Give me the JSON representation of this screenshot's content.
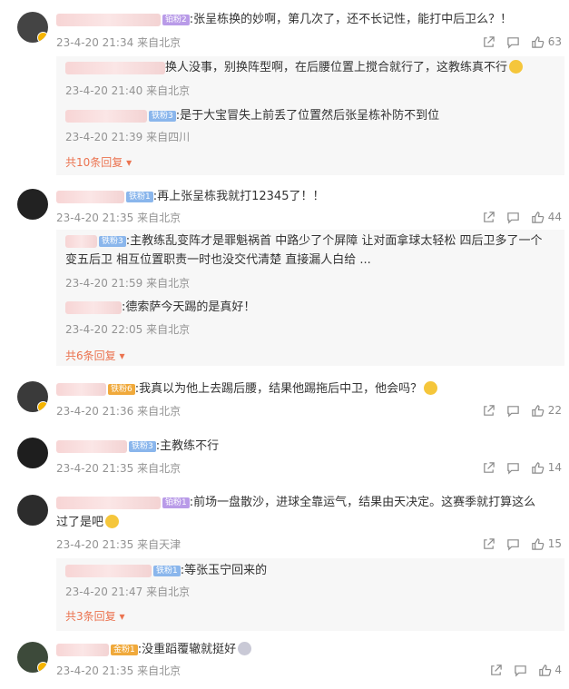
{
  "comments": [
    {
      "badge": "铂粉2",
      "text": ":张呈栋换的妙啊，第几次了，还不长记性，能打中后卫么？！",
      "time": "23-4-20 21:34",
      "location": "来自北京",
      "likes": "63",
      "replies": [
        {
          "text": "换人没事，别换阵型啊，在后腰位置上搅合就行了，这教练真不行",
          "time": "23-4-20 21:40",
          "location": "来自北京"
        },
        {
          "badge": "铁粉3",
          "text": ":是于大宝冒失上前丢了位置然后张呈栋补防不到位",
          "time": "23-4-20 21:39",
          "location": "来自四川"
        }
      ],
      "more": "共10条回复"
    },
    {
      "badge": "铁粉1",
      "text": ":再上张呈栋我就打12345了！！",
      "time": "23-4-20 21:35",
      "location": "来自北京",
      "likes": "44",
      "replies": [
        {
          "badge": "铁粉3",
          "text": ":主教练乱变阵才是罪魁祸首 中路少了个屏障 让对面拿球太轻松  四后卫多了一个",
          "text2": "变五后卫 相互位置职责一时也没交代清楚 直接漏人白给 ...",
          "time": "23-4-20 21:59",
          "location": "来自北京"
        },
        {
          "text": ":德索萨今天踢的是真好！",
          "time": "23-4-20 22:05",
          "location": "来自北京"
        }
      ],
      "more": "共6条回复"
    },
    {
      "badge": "铁粉6",
      "text": ":我真以为他上去踢后腰，结果他踢拖后中卫，他会吗？",
      "time": "23-4-20 21:36",
      "location": "来自北京",
      "likes": "22"
    },
    {
      "badge": "铁粉3",
      "text": ":主教练不行",
      "time": "23-4-20 21:35",
      "location": "来自北京",
      "likes": "14"
    },
    {
      "badge": "铂粉1",
      "text": ":前场一盘散沙，进球全靠运气，结果由天决定。这赛季就打算这么",
      "text2": "过了是吧",
      "time": "23-4-20 21:35",
      "location": "来自天津",
      "likes": "15",
      "replies": [
        {
          "badge": "铁粉1",
          "text": ":等张玉宁回来的",
          "time": "23-4-20 21:47",
          "location": "来自北京"
        }
      ],
      "more": "共3条回复"
    },
    {
      "badge": "金粉1",
      "text": ":没重蹈覆辙就挺好",
      "time": "23-4-20 21:35",
      "location": "来自北京",
      "likes": "4"
    }
  ],
  "colors": {
    "more_link": "#eb7350",
    "meta": "#939393",
    "reply_bg": "#f7f7f7"
  },
  "icons": [
    "share-icon",
    "comment-icon",
    "like-icon"
  ]
}
